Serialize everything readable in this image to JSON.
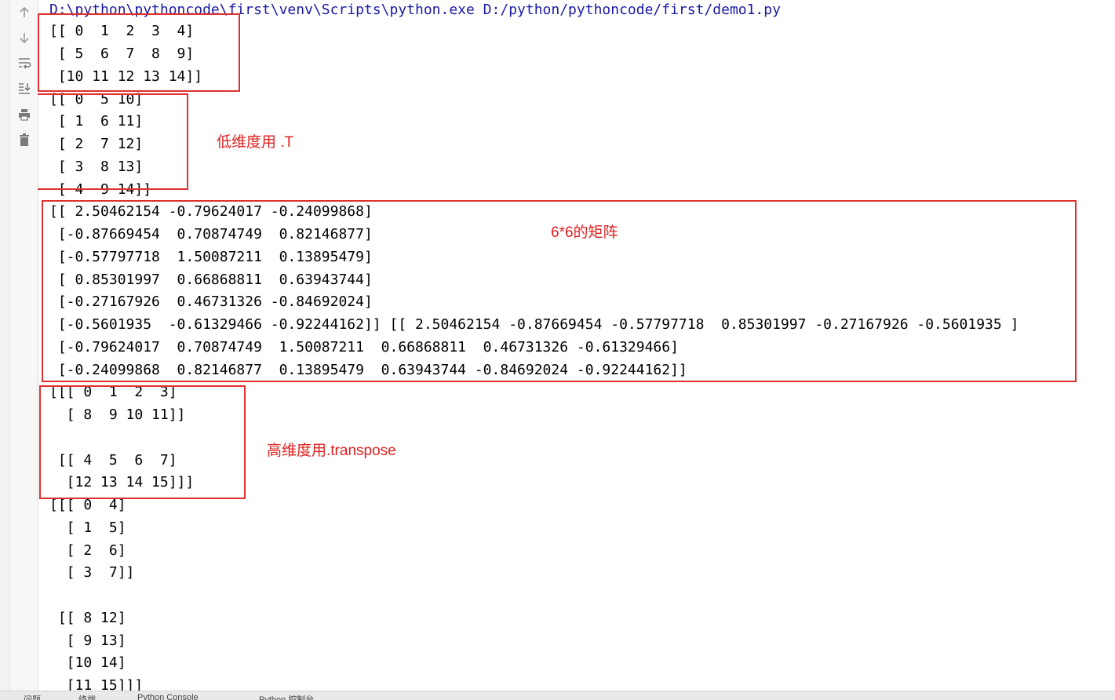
{
  "toolbar": {
    "buttons": [
      {
        "icon": "arrow-up-icon"
      },
      {
        "icon": "arrow-down-icon"
      },
      {
        "icon": "soft-wrap-icon"
      },
      {
        "icon": "scroll-to-end-icon"
      },
      {
        "icon": "print-icon"
      },
      {
        "icon": "trash-icon"
      }
    ]
  },
  "console": {
    "command": "D:\\python\\pythoncode\\first\\venv\\Scripts\\python.exe D:/python/pythoncode/first/demo1.py",
    "lines": [
      "[[ 0  1  2  3  4]",
      " [ 5  6  7  8  9]",
      " [10 11 12 13 14]]",
      "[[ 0  5 10]",
      " [ 1  6 11]",
      " [ 2  7 12]",
      " [ 3  8 13]",
      " [ 4  9 14]]",
      "[[ 2.50462154 -0.79624017 -0.24099868]",
      " [-0.87669454  0.70874749  0.82146877]",
      " [-0.57797718  1.50087211  0.13895479]",
      " [ 0.85301997  0.66868811  0.63943744]",
      " [-0.27167926  0.46731326 -0.84692024]",
      " [-0.5601935  -0.61329466 -0.92244162]] [[ 2.50462154 -0.87669454 -0.57797718  0.85301997 -0.27167926 -0.5601935 ]",
      " [-0.79624017  0.70874749  1.50087211  0.66868811  0.46731326 -0.61329466]",
      " [-0.24099868  0.82146877  0.13895479  0.63943744 -0.84692024 -0.92244162]]",
      "[[[ 0  1  2  3]",
      "  [ 8  9 10 11]]",
      "",
      " [[ 4  5  6  7]",
      "  [12 13 14 15]]]",
      "[[[ 0  4]",
      "  [ 1  5]",
      "  [ 2  6]",
      "  [ 3  7]]",
      "",
      " [[ 8 12]",
      "  [ 9 13]",
      "  [10 14]",
      "  [11 15]]]"
    ]
  },
  "annotations": {
    "low_dim": "低维度用 .T",
    "matrix_6x6": "6*6的矩阵",
    "high_dim": "高维度用.transpose"
  },
  "status_bar": {
    "items": [
      "问题",
      "终端",
      "Python Console",
      "Python 控制台"
    ]
  },
  "colors": {
    "annotation_red": "#e02020",
    "command_blue": "#1a1aa6"
  }
}
